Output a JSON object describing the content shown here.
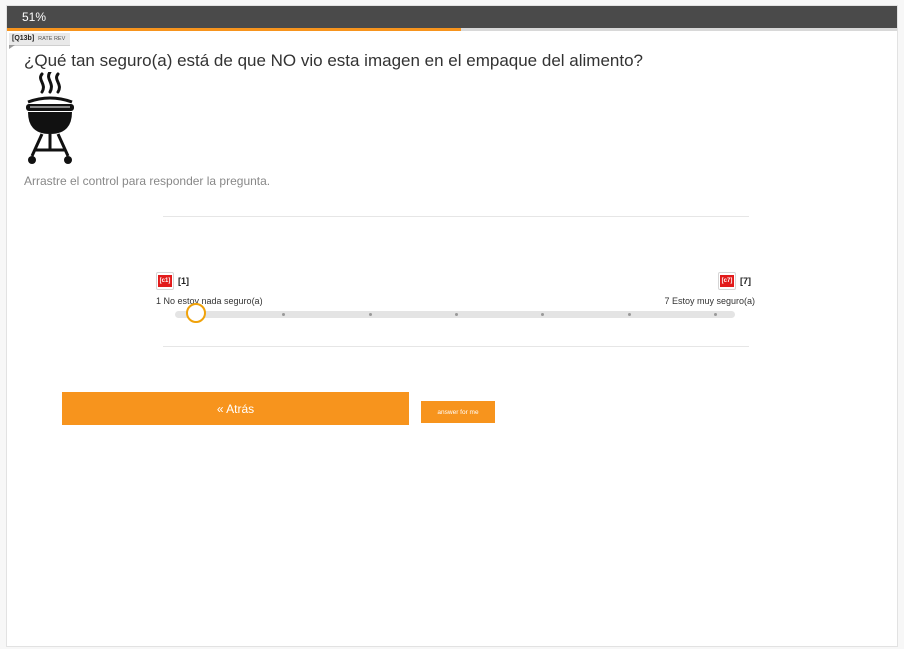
{
  "progress": {
    "label": "51%",
    "value": 0.51
  },
  "question": {
    "code": "[Q13b]",
    "subtag": "RATE REV",
    "text": "¿Qué tan seguro(a) está de que NO vio esta imagen en el empaque del alimento?",
    "image_icon": "barbecue-grill-icon",
    "instruction": "Arrastre el control para responder la pregunta."
  },
  "scale": {
    "left_badge": "[c1]",
    "left_code": "[1]",
    "left_label": "1 No estoy nada seguro(a)",
    "right_badge": "[c7]",
    "right_code": "[7]",
    "right_label": "7 Estoy muy seguro(a)",
    "steps": 7,
    "selected": 1
  },
  "buttons": {
    "back": "« Atrás",
    "answer_for_me": "answer for me"
  },
  "colors": {
    "accent": "#f7941d",
    "topbar": "#4a4a4a",
    "badge_red": "#e21b1b"
  }
}
